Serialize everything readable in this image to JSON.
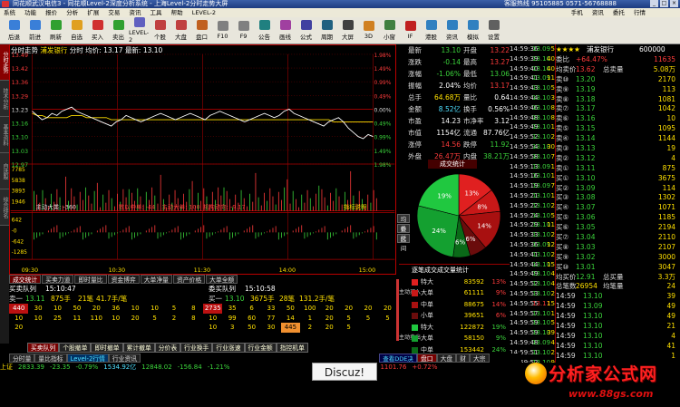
{
  "window": {
    "title": "同花顺武汉电信3 - 同花顺Level-2深度分析系统 - 上海Level-2分时走势大屏",
    "right_info": "客服热线 95105885 0571-56768888",
    "controls": [
      "_",
      "□",
      "×"
    ]
  },
  "menu": {
    "items": [
      "系统",
      "功能",
      "报价",
      "分析",
      "扩展",
      "交易",
      "资讯",
      "工具",
      "帮助",
      "LEVEL-2"
    ],
    "right": [
      "手机",
      "资讯",
      "委托",
      "行情"
    ]
  },
  "toolbar": {
    "buttons": [
      {
        "label": "后退",
        "color": "#3a7fd8"
      },
      {
        "label": "前进",
        "color": "#3a7fd8"
      },
      {
        "label": "刷新",
        "color": "#30a030"
      },
      {
        "label": "自选",
        "color": "#e0a020"
      },
      {
        "label": "买入",
        "color": "#d03030"
      },
      {
        "label": "卖出",
        "color": "#30a030"
      },
      {
        "label": "LEVEL-2",
        "color": "#6060c0"
      },
      {
        "label": "个股",
        "color": "#c04040"
      },
      {
        "label": "大盘",
        "color": "#c04040"
      },
      {
        "label": "盘口",
        "color": "#c06020"
      },
      {
        "label": "F10",
        "color": "#808080"
      },
      {
        "label": "F9",
        "color": "#808080"
      },
      {
        "label": "公告",
        "color": "#208080"
      },
      {
        "label": "画线",
        "color": "#a040a0"
      },
      {
        "label": "公式",
        "color": "#4040a0"
      },
      {
        "label": "周期",
        "color": "#206080"
      },
      {
        "label": "大屏",
        "color": "#404040"
      },
      {
        "label": "3D",
        "color": "#d08020"
      },
      {
        "label": "小窗",
        "color": "#408040"
      },
      {
        "label": "IF",
        "color": "#c02020"
      },
      {
        "label": "港股",
        "color": "#3080c0"
      },
      {
        "label": "资讯",
        "color": "#3080c0"
      },
      {
        "label": "模拟",
        "color": "#3080c0"
      },
      {
        "label": "设置",
        "color": "#606060"
      }
    ]
  },
  "left_tabs": [
    "分时走势",
    "技术分析",
    "基本资料",
    "自选股",
    "综合排名"
  ],
  "chart_header": {
    "label": "分时走势",
    "stock": "浦发银行",
    "avg": "分时 均价: 13.17",
    "latest": "最新: 13.10"
  },
  "chart_data": {
    "type": "line",
    "prev_close": 13.23,
    "price_left_labels": [
      "13.49",
      "13.42",
      "13.36",
      "13.29",
      "13.23",
      "13.16",
      "13.10",
      "13.03",
      "12.97"
    ],
    "pct_right_labels": [
      "1.98%",
      "1.49%",
      "0.99%",
      "0.49%",
      "0.00%",
      "0.49%",
      "0.99%",
      "1.49%",
      "1.98%"
    ],
    "volume_labels": [
      "7785",
      "5838",
      "3893",
      "1946"
    ],
    "time_labels": [
      "09:30",
      "10:30",
      "11:30",
      "14:00",
      "15:00"
    ],
    "price": [
      13.22,
      13.2,
      13.18,
      13.19,
      13.21,
      13.2,
      13.22,
      13.23,
      13.24,
      13.22,
      13.21,
      13.2,
      13.19,
      13.18,
      13.17,
      13.16,
      13.15,
      13.17,
      13.18,
      13.2,
      13.19,
      13.18,
      13.17,
      13.18,
      13.19,
      13.2,
      13.21,
      13.2,
      13.19,
      13.18,
      13.19,
      13.2,
      13.21,
      13.2,
      13.19,
      13.18,
      13.2,
      13.21,
      13.22,
      13.21,
      13.2,
      13.19,
      13.18,
      13.17,
      13.18,
      13.19,
      13.2,
      13.21,
      13.2,
      13.19,
      13.2,
      13.22,
      13.23,
      13.21,
      13.2,
      13.19,
      13.18,
      13.17,
      13.16,
      13.15,
      13.17,
      13.18,
      13.19,
      13.17,
      13.14,
      13.12,
      13.1,
      13.09,
      13.11,
      13.1
    ],
    "avg": [
      13.21,
      13.2,
      13.2,
      13.19,
      13.19,
      13.19,
      13.19,
      13.19,
      13.2,
      13.2,
      13.2,
      13.19,
      13.19,
      13.19,
      13.19,
      13.19,
      13.18,
      13.18,
      13.18,
      13.18,
      13.18,
      13.18,
      13.18,
      13.18,
      13.18,
      13.18,
      13.18,
      13.18,
      13.18,
      13.18,
      13.18,
      13.18,
      13.18,
      13.18,
      13.18,
      13.18,
      13.18,
      13.18,
      13.18,
      13.18,
      13.18,
      13.18,
      13.18,
      13.18,
      13.18,
      13.18,
      13.18,
      13.18,
      13.18,
      13.18,
      13.18,
      13.18,
      13.18,
      13.18,
      13.18,
      13.18,
      13.18,
      13.18,
      13.18,
      13.18,
      13.18,
      13.17,
      13.17,
      13.17,
      13.17,
      13.17,
      13.17,
      13.17,
      13.17,
      13.17
    ],
    "legend": {
      "main": "主动大类: -360",
      "other": "数以中单: -44",
      "big": "主动大单: 100",
      "inst": "机构动向: -9.17",
      "indicator": "指标说明"
    },
    "sub_labels": [
      "642",
      "-0",
      "-642",
      "-1285"
    ]
  },
  "quotes": [
    {
      "k1": "最新",
      "v1": "13.10",
      "c1": "green",
      "k2": "开盘",
      "v2": "13.22",
      "c2": "red"
    },
    {
      "k1": "涨跌",
      "v1": "-0.14",
      "c1": "green",
      "k2": "最高",
      "v2": "13.27",
      "c2": "red"
    },
    {
      "k1": "涨幅",
      "v1": "-1.06%",
      "c1": "green",
      "k2": "最低",
      "v2": "13.06",
      "c2": "green"
    },
    {
      "k1": "振幅",
      "v1": "2.04%",
      "c1": "white",
      "k2": "均价",
      "v2": "13.17",
      "c2": "red"
    },
    {
      "k1": "总手",
      "v1": "64.68万",
      "c1": "yel",
      "k2": "量比",
      "v2": "0.64",
      "c2": "white"
    },
    {
      "k1": "金额",
      "v1": "8.52亿",
      "c1": "cyan",
      "k2": "换手",
      "v2": "0.56%",
      "c2": "white"
    },
    {
      "k1": "市盈",
      "v1": "14.23",
      "c1": "white",
      "k2": "市净率",
      "v2": "3.12",
      "c2": "white"
    },
    {
      "k1": "市值",
      "v1": "1154亿",
      "c1": "white",
      "k2": "流通",
      "v2": "87.76亿",
      "c2": "white"
    },
    {
      "k1": "涨停",
      "v1": "14.56",
      "c1": "red",
      "k2": "跌停",
      "v2": "11.92",
      "c2": "green"
    },
    {
      "k1": "外盘",
      "v1": "26.47万",
      "c1": "red",
      "k2": "内盘",
      "v2": "38.21万",
      "c2": "green"
    }
  ],
  "ddx": {
    "title": "成交统计",
    "tabs": [
      "均价",
      "委托",
      "区间"
    ],
    "pie": [
      {
        "label": "13%",
        "value": 13,
        "color": "#e02020"
      },
      {
        "label": "8%",
        "value": 8,
        "color": "#c81818"
      },
      {
        "label": "14%",
        "value": 14,
        "color": "#a81010"
      },
      {
        "label": "6%",
        "value": 6,
        "color": "#6a0c0c"
      },
      {
        "label": "6%",
        "value": 6,
        "color": "#0a6a18"
      },
      {
        "label": "24%",
        "value": 24,
        "color": "#14a030"
      },
      {
        "label": "19%",
        "value": 19,
        "color": "#20c840"
      }
    ],
    "table_title": "逐笔成交成交量统计",
    "buy_side": "主动买入",
    "sell_side": "主动卖出",
    "rows": [
      {
        "label": "特大",
        "value": "83592",
        "pct": "13%",
        "color": "#e02020",
        "pc": "red"
      },
      {
        "label": "大单",
        "value": "61111",
        "pct": "9%",
        "color": "#c81818",
        "pc": "red"
      },
      {
        "label": "中单",
        "value": "88675",
        "pct": "14%",
        "color": "#a81010",
        "pc": "red"
      },
      {
        "label": "小单",
        "value": "39651",
        "pct": "6%",
        "color": "#6a0c0c",
        "pc": "red"
      },
      {
        "label": "特大",
        "value": "122872",
        "pct": "19%",
        "color": "#20c840",
        "pc": "green"
      },
      {
        "label": "大单",
        "value": "58150",
        "pct": "9%",
        "color": "#14a030",
        "pc": "green"
      },
      {
        "label": "中单",
        "value": "153442",
        "pct": "24%",
        "color": "#0a6a18",
        "pc": "green"
      },
      {
        "label": "小单",
        "value": "37896",
        "pct": "6%",
        "color": "#064010",
        "pc": "green"
      }
    ]
  },
  "panel_tabs": [
    "成交统计",
    "买卖力道",
    "即时量比",
    "资金博弈",
    "大单净量",
    "资产价格",
    "大单全额"
  ],
  "queue": {
    "buy_title": "买卖队列",
    "buy_time": "15:10:47",
    "sell_title": "委买队列",
    "sell_time": "15:10:58",
    "left_head": [
      "卖一",
      "13.11",
      "875手",
      "21笔",
      "41.7手/笔"
    ],
    "right_head": [
      "买一",
      "13.10",
      "3675手",
      "28笔",
      "131.2手/笔"
    ],
    "left_rows": [
      [
        "440",
        "30",
        "10",
        "50",
        "20",
        "36",
        "10",
        "10",
        "5",
        "8"
      ],
      [
        "10",
        "10",
        "25",
        "11",
        "110",
        "10",
        "20",
        "5",
        "2",
        "8"
      ],
      [
        "20",
        "",
        "",
        "",
        "",
        "",
        "",
        "",
        "",
        ""
      ]
    ],
    "right_rows": [
      [
        "2735",
        "35",
        "6",
        "33",
        "50",
        "100",
        "20",
        "20",
        "20",
        "20"
      ],
      [
        "10",
        "99",
        "60",
        "77",
        "14",
        "1",
        "20",
        "5",
        "5",
        "5"
      ],
      [
        "10",
        "3",
        "50",
        "30",
        "445",
        "2",
        "20",
        "5",
        "",
        ""
      ]
    ]
  },
  "footer_tabs": [
    "买卖队列",
    "个股撤单",
    "即时撤单",
    "累计撤单",
    "分价表",
    "行业换手",
    "行业涨速",
    "行业金额",
    "指控机单"
  ],
  "footer_tabs2": [
    "分时量",
    "量比指标",
    "Level-2行情",
    "行业资讯"
  ],
  "status": {
    "sh": "上证",
    "sh_val": "2833.39",
    "sh_chg": "-23.35",
    "sh_pct": "-0.79%",
    "sh_amt": "1534.92亿",
    "sz_val": "12848.02",
    "sz_chg": "-156.84",
    "sz_pct": "-1.21%",
    "dd_btn": "查看DDE决策",
    "bottom2": [
      "盘口",
      "大盘",
      "财",
      "大宗"
    ],
    "b_price": "1101.76",
    "b_chg": "+0.72%"
  },
  "ticks": [
    [
      "14:59:36",
      "13.09",
      "5"
    ],
    [
      "14:59:39",
      "13.10",
      "40"
    ],
    [
      "14:59:40",
      "13.10",
      "40"
    ],
    [
      "14:59:41",
      "13.09",
      "11"
    ],
    [
      "14:59:43",
      "13.10",
      "5"
    ],
    [
      "14:59:44",
      "13.10",
      "3"
    ],
    [
      "14:59:46",
      "13.10",
      "8"
    ],
    [
      "14:59:48",
      "13.10",
      "8"
    ],
    [
      "14:59:49",
      "13.10",
      "1"
    ],
    [
      "14:59:52",
      "13.10",
      "2"
    ],
    [
      "14:59:54",
      "13.10",
      "30"
    ],
    [
      "14:59:58",
      "13.10",
      "7"
    ],
    [
      "14:59:13",
      "13.09",
      "1"
    ],
    [
      "14:59:16",
      "13.10",
      "1"
    ],
    [
      "14:59:19",
      "13.09",
      "7"
    ],
    [
      "14:59:21",
      "13.10",
      "1"
    ],
    [
      "14:59:22",
      "13.10",
      "2"
    ],
    [
      "14:59:24",
      "13.10",
      "5"
    ],
    [
      "14:59:29",
      "13.10",
      "11"
    ],
    [
      "14:59:33",
      "13.10",
      "2"
    ],
    [
      "14:59:36",
      "13.09",
      "12"
    ],
    [
      "14:59:41",
      "13.10",
      "2"
    ],
    [
      "14:59:44",
      "13.10",
      "15"
    ],
    [
      "14:59:49",
      "13.10",
      "4"
    ],
    [
      "14:59:52",
      "13.10",
      "4"
    ],
    [
      "14:59:53",
      "13.10",
      "2"
    ],
    [
      "14:59:55",
      "13.11",
      "15"
    ],
    [
      "14:59:57",
      "13.10",
      "1"
    ],
    [
      "14:59:59",
      "13.10",
      "5"
    ],
    [
      "14:59:59",
      "13.10",
      "39"
    ],
    [
      "14:59:48",
      "13.09",
      "4"
    ],
    [
      "14:59:51",
      "13.10",
      "2"
    ],
    [
      "14:59:52",
      "13.10",
      "9"
    ],
    [
      "14:59:53",
      "13.10",
      "7"
    ],
    [
      "14:59:57",
      "13.10",
      "26"
    ]
  ],
  "r2": {
    "title": "浦发银行",
    "code": "600000",
    "stars": "★★★★",
    "weibi_label": "委比",
    "weibi_val": "+64.47%",
    "weicha": "11635",
    "junjia_label": "均卖价",
    "junjia": "13.62",
    "total_sell_label": "总卖量",
    "total_sell": "5.08万",
    "sell": [
      [
        "卖⑩",
        "13.20",
        "2170"
      ],
      [
        "卖⑨",
        "13.19",
        "113"
      ],
      [
        "卖⑧",
        "13.18",
        "1081"
      ],
      [
        "卖⑦",
        "13.17",
        "1042"
      ],
      [
        "卖⑥",
        "13.16",
        "10"
      ],
      [
        "卖⑤",
        "13.15",
        "1095"
      ],
      [
        "卖④",
        "13.14",
        "1144"
      ],
      [
        "卖③",
        "13.13",
        "19"
      ],
      [
        "卖②",
        "13.12",
        "4"
      ],
      [
        "卖①",
        "13.11",
        "875"
      ]
    ],
    "buy": [
      [
        "买①",
        "13.10",
        "3675"
      ],
      [
        "买②",
        "13.09",
        "114"
      ],
      [
        "买③",
        "13.08",
        "1302"
      ],
      [
        "买④",
        "13.07",
        "1071"
      ],
      [
        "买⑤",
        "13.06",
        "1185"
      ],
      [
        "买⑥",
        "13.05",
        "2194"
      ],
      [
        "买⑦",
        "13.04",
        "2110"
      ],
      [
        "买⑧",
        "13.03",
        "2107"
      ],
      [
        "买⑨",
        "13.02",
        "3000"
      ],
      [
        "买⑩",
        "13.01",
        "3047"
      ]
    ],
    "avg_buy_label": "均买价",
    "avg_buy": "12.91",
    "total_buy_label": "总买量",
    "total_buy": "3.3万",
    "trades_label": "总笔数",
    "trades": "26954",
    "per_label": "均笔量",
    "per": "24",
    "bottom_ticks": [
      [
        "14:59",
        "13.10",
        "39"
      ],
      [
        "14:59",
        "13.09",
        "49"
      ],
      [
        "14:59",
        "13.10",
        "49"
      ],
      [
        "14:59",
        "13.10",
        "21"
      ],
      [
        "14:59",
        "13.10",
        "4"
      ],
      [
        "14:59",
        "13.10",
        "41"
      ],
      [
        "14:59",
        "13.10",
        "1"
      ],
      [
        "14:59",
        "13.10",
        "5"
      ],
      [
        "14:59",
        "13.10",
        "12"
      ],
      [
        "15:00",
        "13.10",
        "8"
      ]
    ]
  },
  "discuz": "Discuz!",
  "logo": {
    "brand": "分析家公式网",
    "site": "www.88gs.com"
  }
}
